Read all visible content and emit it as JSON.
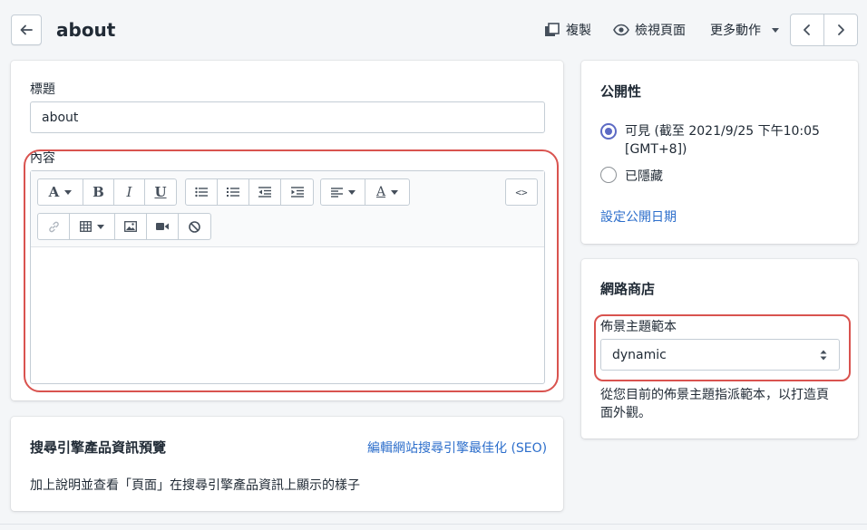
{
  "header": {
    "title": "about",
    "actions": {
      "duplicate": "複製",
      "view_page": "檢視頁面",
      "more_actions": "更多動作"
    }
  },
  "page_form": {
    "title_label": "標題",
    "title_value": "about",
    "content_label": "內容"
  },
  "seo": {
    "title": "搜尋引擎產品資訊預覽",
    "edit_link": "編輯網站搜尋引擎最佳化 (SEO)",
    "description": "加上說明並查看「頁面」在搜尋引擎產品資訊上顯示的樣子"
  },
  "visibility": {
    "title": "公開性",
    "visible_label": "可見 (截至 2021/9/25 下午10:05",
    "visible_label_2": "[GMT+8])",
    "hidden_label": "已隱藏",
    "set_date_link": "設定公開日期",
    "selected": "visible"
  },
  "online_store": {
    "title": "網路商店",
    "template_label": "佈景主題範本",
    "template_value": "dynamic",
    "help_line1": "從您目前的佈景主題指派範本，以打造頁",
    "help_line2": "面外觀。"
  },
  "colors": {
    "accent": "#5c6ac4",
    "link": "#2c6ecb",
    "highlight": "#d9534f"
  }
}
